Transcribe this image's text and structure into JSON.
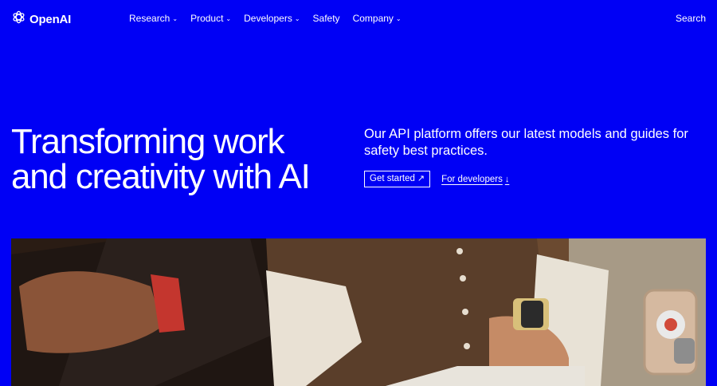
{
  "nav": {
    "logo_text": "OpenAI",
    "items": [
      {
        "label": "Research",
        "has_dropdown": true
      },
      {
        "label": "Product",
        "has_dropdown": true
      },
      {
        "label": "Developers",
        "has_dropdown": true
      },
      {
        "label": "Safety",
        "has_dropdown": false
      },
      {
        "label": "Company",
        "has_dropdown": true
      }
    ],
    "search_label": "Search"
  },
  "hero": {
    "headline": "Transforming work and creativity with AI",
    "description": "Our API platform offers our latest models and guides for safety best practices.",
    "primary_cta": "Get started",
    "primary_cta_icon": "arrow-up-right-icon",
    "secondary_cta": "For developers",
    "secondary_cta_icon": "arrow-down-icon"
  },
  "colors": {
    "background": "#0000f5",
    "text": "#ffffff"
  }
}
